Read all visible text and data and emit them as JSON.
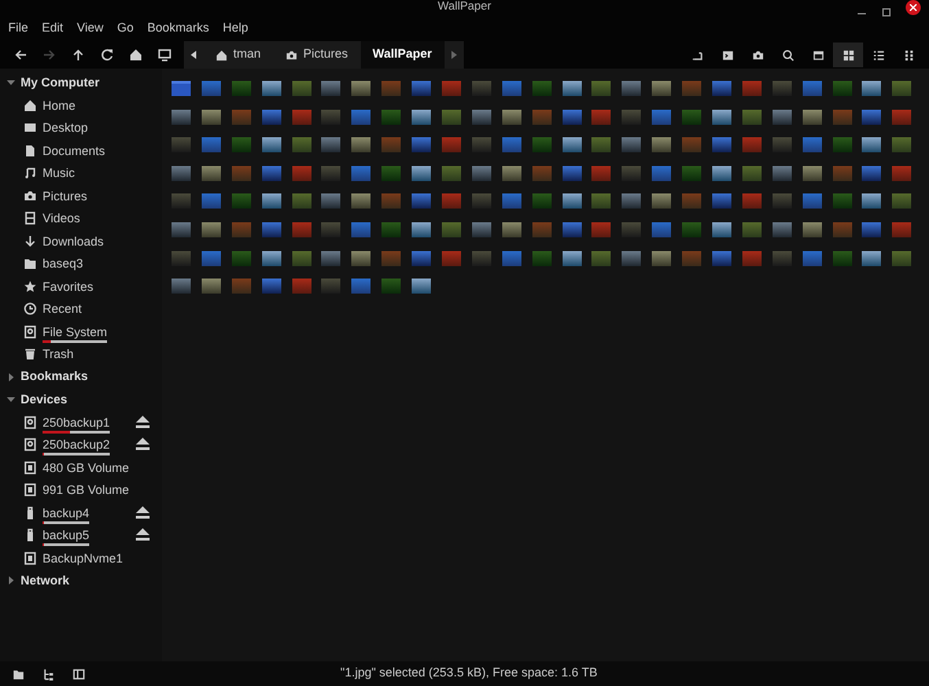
{
  "window": {
    "title": "WallPaper"
  },
  "menu": [
    "File",
    "Edit",
    "View",
    "Go",
    "Bookmarks",
    "Help"
  ],
  "nav_buttons": [
    {
      "kind": "back",
      "disabled": false
    },
    {
      "kind": "forward",
      "disabled": true
    },
    {
      "kind": "up",
      "disabled": false
    },
    {
      "kind": "reload",
      "disabled": false
    },
    {
      "kind": "home",
      "disabled": false
    },
    {
      "kind": "computer",
      "disabled": false
    }
  ],
  "breadcrumbs": [
    {
      "label": "tman",
      "kind": "home",
      "selected": false
    },
    {
      "label": "Pictures",
      "kind": "pictures",
      "selected": false
    },
    {
      "label": "WallPaper",
      "kind": "plain",
      "selected": true
    }
  ],
  "view_tools": [
    {
      "kind": "toggle-location"
    },
    {
      "kind": "terminal"
    },
    {
      "kind": "camera"
    },
    {
      "kind": "search"
    },
    {
      "kind": "preview"
    },
    {
      "kind": "icon-view",
      "selected": true
    },
    {
      "kind": "list-view",
      "selected": false
    },
    {
      "kind": "compact-view",
      "selected": false
    }
  ],
  "sidebar": {
    "sections": [
      {
        "label": "My Computer",
        "expanded": true,
        "items": [
          {
            "label": "Home",
            "kind": "home",
            "ejectable": false
          },
          {
            "label": "Desktop",
            "kind": "desktop",
            "ejectable": false
          },
          {
            "label": "Documents",
            "kind": "documents",
            "ejectable": false
          },
          {
            "label": "Music",
            "kind": "music",
            "ejectable": false
          },
          {
            "label": "Pictures",
            "kind": "pictures",
            "ejectable": false
          },
          {
            "label": "Videos",
            "kind": "videos",
            "ejectable": false
          },
          {
            "label": "Downloads",
            "kind": "downloads",
            "ejectable": false
          },
          {
            "label": "baseq3",
            "kind": "folder",
            "ejectable": false
          },
          {
            "label": "Favorites",
            "kind": "favorites",
            "ejectable": false
          },
          {
            "label": "Recent",
            "kind": "recent",
            "ejectable": false
          },
          {
            "label": "File System",
            "kind": "drive",
            "ejectable": false,
            "level": 0.12
          },
          {
            "label": "Trash",
            "kind": "trash",
            "ejectable": false
          }
        ]
      },
      {
        "label": "Bookmarks",
        "expanded": false
      },
      {
        "label": "Devices",
        "expanded": true,
        "items": [
          {
            "label": "250backup1",
            "kind": "drive",
            "ejectable": true,
            "level": 0.4
          },
          {
            "label": "250backup2",
            "kind": "drive",
            "ejectable": true,
            "level": 0.03
          },
          {
            "label": "480 GB Volume",
            "kind": "volume",
            "ejectable": false
          },
          {
            "label": "991 GB Volume",
            "kind": "volume",
            "ejectable": false
          },
          {
            "label": "backup4",
            "kind": "usb",
            "ejectable": true,
            "level": 0.03
          },
          {
            "label": "backup5",
            "kind": "usb",
            "ejectable": true,
            "level": 0.03
          },
          {
            "label": "BackupNvme1",
            "kind": "volume",
            "ejectable": false
          }
        ]
      },
      {
        "label": "Network",
        "expanded": false
      }
    ]
  },
  "thumbnails": [
    {
      "kind": "folder"
    },
    {
      "kind": "image"
    },
    {
      "kind": "image"
    },
    {
      "kind": "image"
    },
    {
      "kind": "image"
    },
    {
      "kind": "image"
    },
    {
      "kind": "image"
    },
    {
      "kind": "image"
    },
    {
      "kind": "image"
    },
    {
      "kind": "image"
    },
    {
      "kind": "image"
    },
    {
      "kind": "image"
    },
    {
      "kind": "image"
    },
    {
      "kind": "image"
    },
    {
      "kind": "image"
    },
    {
      "kind": "image"
    },
    {
      "kind": "image"
    },
    {
      "kind": "image"
    },
    {
      "kind": "image"
    },
    {
      "kind": "image"
    },
    {
      "kind": "image"
    },
    {
      "kind": "image"
    },
    {
      "kind": "image"
    },
    {
      "kind": "image"
    },
    {
      "kind": "image"
    },
    {
      "kind": "image"
    },
    {
      "kind": "image"
    },
    {
      "kind": "image"
    },
    {
      "kind": "image"
    },
    {
      "kind": "image"
    },
    {
      "kind": "image"
    },
    {
      "kind": "image"
    },
    {
      "kind": "image"
    },
    {
      "kind": "image"
    },
    {
      "kind": "image"
    },
    {
      "kind": "image"
    },
    {
      "kind": "image"
    },
    {
      "kind": "image"
    },
    {
      "kind": "image"
    },
    {
      "kind": "image"
    },
    {
      "kind": "image"
    },
    {
      "kind": "image"
    },
    {
      "kind": "image"
    },
    {
      "kind": "image"
    },
    {
      "kind": "image"
    },
    {
      "kind": "image"
    },
    {
      "kind": "image"
    },
    {
      "kind": "image"
    },
    {
      "kind": "image"
    },
    {
      "kind": "image"
    },
    {
      "kind": "image"
    },
    {
      "kind": "image"
    },
    {
      "kind": "image"
    },
    {
      "kind": "image"
    },
    {
      "kind": "image"
    },
    {
      "kind": "image"
    },
    {
      "kind": "image"
    },
    {
      "kind": "image"
    },
    {
      "kind": "image"
    },
    {
      "kind": "image"
    },
    {
      "kind": "image"
    },
    {
      "kind": "image"
    },
    {
      "kind": "image"
    },
    {
      "kind": "image"
    },
    {
      "kind": "image"
    },
    {
      "kind": "image"
    },
    {
      "kind": "image"
    },
    {
      "kind": "image"
    },
    {
      "kind": "image"
    },
    {
      "kind": "image"
    },
    {
      "kind": "image"
    },
    {
      "kind": "image"
    },
    {
      "kind": "image"
    },
    {
      "kind": "image"
    },
    {
      "kind": "image"
    },
    {
      "kind": "image"
    },
    {
      "kind": "image"
    },
    {
      "kind": "image"
    },
    {
      "kind": "image"
    },
    {
      "kind": "image"
    },
    {
      "kind": "image"
    },
    {
      "kind": "image"
    },
    {
      "kind": "image"
    },
    {
      "kind": "image"
    },
    {
      "kind": "image"
    },
    {
      "kind": "image"
    },
    {
      "kind": "image"
    },
    {
      "kind": "image"
    },
    {
      "kind": "image"
    },
    {
      "kind": "image"
    },
    {
      "kind": "image"
    },
    {
      "kind": "image"
    },
    {
      "kind": "image"
    },
    {
      "kind": "image"
    },
    {
      "kind": "image"
    },
    {
      "kind": "image"
    },
    {
      "kind": "image"
    },
    {
      "kind": "image"
    },
    {
      "kind": "image"
    },
    {
      "kind": "image"
    },
    {
      "kind": "image"
    },
    {
      "kind": "image"
    },
    {
      "kind": "image"
    },
    {
      "kind": "image"
    },
    {
      "kind": "image"
    },
    {
      "kind": "image"
    },
    {
      "kind": "image"
    },
    {
      "kind": "image"
    },
    {
      "kind": "image"
    },
    {
      "kind": "image"
    },
    {
      "kind": "image"
    },
    {
      "kind": "image"
    },
    {
      "kind": "image"
    },
    {
      "kind": "image"
    },
    {
      "kind": "image"
    },
    {
      "kind": "image"
    },
    {
      "kind": "image"
    },
    {
      "kind": "image"
    },
    {
      "kind": "image"
    },
    {
      "kind": "image"
    },
    {
      "kind": "image"
    },
    {
      "kind": "image"
    },
    {
      "kind": "image"
    },
    {
      "kind": "image"
    },
    {
      "kind": "image"
    },
    {
      "kind": "image"
    },
    {
      "kind": "image"
    },
    {
      "kind": "image"
    },
    {
      "kind": "image"
    },
    {
      "kind": "image"
    },
    {
      "kind": "image"
    },
    {
      "kind": "image"
    },
    {
      "kind": "image"
    },
    {
      "kind": "image"
    },
    {
      "kind": "image"
    },
    {
      "kind": "image"
    },
    {
      "kind": "image"
    },
    {
      "kind": "image"
    },
    {
      "kind": "image"
    },
    {
      "kind": "image"
    },
    {
      "kind": "image"
    },
    {
      "kind": "image"
    },
    {
      "kind": "image"
    },
    {
      "kind": "image"
    },
    {
      "kind": "image"
    },
    {
      "kind": "image"
    },
    {
      "kind": "image"
    },
    {
      "kind": "image"
    },
    {
      "kind": "image"
    },
    {
      "kind": "image"
    },
    {
      "kind": "image"
    },
    {
      "kind": "image"
    },
    {
      "kind": "image"
    },
    {
      "kind": "image"
    },
    {
      "kind": "image"
    },
    {
      "kind": "image"
    },
    {
      "kind": "image"
    },
    {
      "kind": "image"
    },
    {
      "kind": "image"
    },
    {
      "kind": "image"
    },
    {
      "kind": "image"
    },
    {
      "kind": "image"
    },
    {
      "kind": "image"
    },
    {
      "kind": "image"
    },
    {
      "kind": "image"
    },
    {
      "kind": "image"
    },
    {
      "kind": "image"
    },
    {
      "kind": "image"
    },
    {
      "kind": "image"
    },
    {
      "kind": "image"
    },
    {
      "kind": "image"
    },
    {
      "kind": "image"
    },
    {
      "kind": "image"
    },
    {
      "kind": "image"
    },
    {
      "kind": "image"
    },
    {
      "kind": "image"
    },
    {
      "kind": "image"
    },
    {
      "kind": "image"
    },
    {
      "kind": "image"
    },
    {
      "kind": "image"
    },
    {
      "kind": "image"
    },
    {
      "kind": "image"
    },
    {
      "kind": "image"
    },
    {
      "kind": "image"
    }
  ],
  "bottom_buttons": [
    {
      "kind": "places"
    },
    {
      "kind": "tree"
    },
    {
      "kind": "toggle-sidebar"
    }
  ],
  "status_bar": {
    "text": "\"1.jpg\" selected (253.5 kB), Free space: 1.6 TB"
  }
}
